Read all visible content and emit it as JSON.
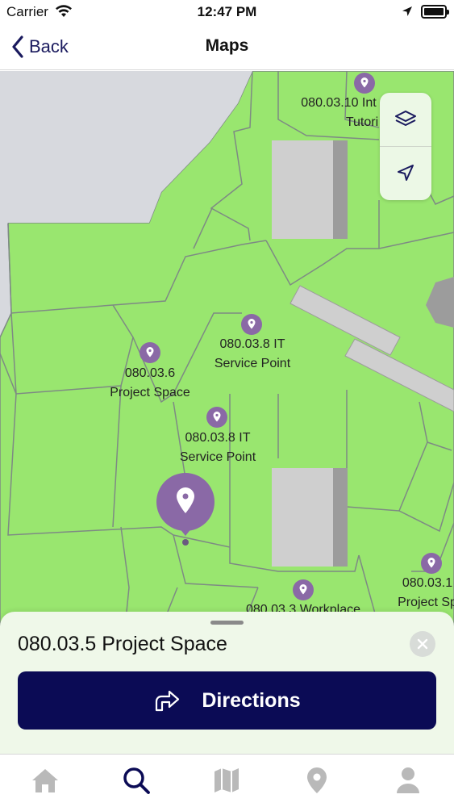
{
  "status_bar": {
    "carrier": "Carrier",
    "time": "12:47 PM"
  },
  "nav": {
    "back_label": "Back",
    "title": "Maps"
  },
  "map": {
    "labels": [
      {
        "id": "top",
        "lines": [
          "080.03.10 Int",
          "Tutori"
        ]
      },
      {
        "id": "it-upper",
        "lines": [
          "080.03.8 IT",
          "Service Point"
        ]
      },
      {
        "id": "project-6",
        "lines": [
          "080.03.6",
          "Project Space"
        ]
      },
      {
        "id": "it-lower",
        "lines": [
          "080.03.8 IT",
          "Service Point"
        ]
      },
      {
        "id": "right",
        "lines": [
          "080.03.1",
          "Project Sp"
        ]
      },
      {
        "id": "workplace",
        "lines": [
          "080.03.3 Workplace"
        ]
      }
    ]
  },
  "sheet": {
    "title": "080.03.5 Project Space",
    "directions_label": "Directions"
  },
  "tabs": [
    "home-icon",
    "search-icon",
    "map-icon",
    "location-pin-icon",
    "profile-icon"
  ],
  "colors": {
    "floor": "#99e66f",
    "walls": "#7e8a84",
    "pin": "#8a69a6",
    "primary": "#0b0b55",
    "active_tab": "#0b0b55",
    "inactive_tab": "#b9b9b9"
  }
}
